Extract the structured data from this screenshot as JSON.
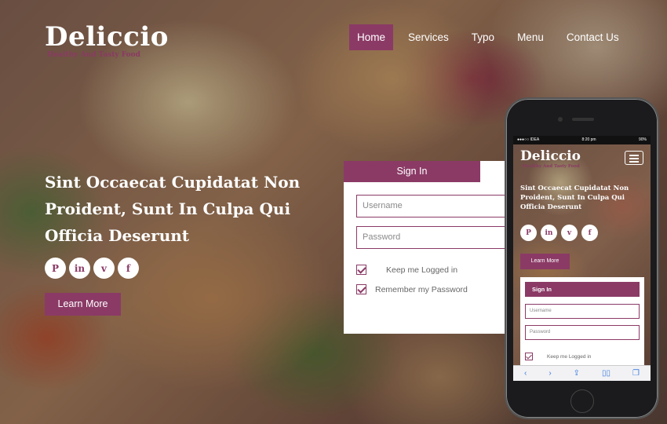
{
  "brand": {
    "title": "Deliccio",
    "tagline": "Healthy And Tasty Food"
  },
  "nav": {
    "items": [
      {
        "label": "Home",
        "active": true
      },
      {
        "label": "Services",
        "active": false
      },
      {
        "label": "Typo",
        "active": false
      },
      {
        "label": "Menu",
        "active": false
      },
      {
        "label": "Contact Us",
        "active": false
      }
    ]
  },
  "hero": {
    "title": "Sint Occaecat Cupidatat Non Proident, Sunt In Culpa Qui Officia Deserunt",
    "learn_more": "Learn More"
  },
  "social": [
    {
      "icon": "pinterest-icon",
      "glyph": "P"
    },
    {
      "icon": "linkedin-icon",
      "glyph": "in"
    },
    {
      "icon": "vimeo-icon",
      "glyph": "v"
    },
    {
      "icon": "facebook-icon",
      "glyph": "f"
    }
  ],
  "signin": {
    "tab": "Sign In",
    "username_placeholder": "Username",
    "password_placeholder": "Password",
    "keep_logged": "Keep me Logged in",
    "remember": "Remember my Password"
  },
  "phone": {
    "status_carrier": "●●●○○ IDEA",
    "status_time": "8:20 pm",
    "status_battery": "90%",
    "brand_title": "Deliccio",
    "brand_tagline": "Healthy And Tasty Food",
    "hero_title": "Sint Occaecat Cupidatat Non Proident, Sunt In Culpa Qui Officia Deserunt",
    "learn_more": "Learn More",
    "signin_tab": "Sign In",
    "username_placeholder": "Username",
    "password_placeholder": "Password",
    "keep_logged": "Keep me Logged in"
  },
  "colors": {
    "accent": "#8b3a66",
    "text_light": "#ffffff"
  }
}
